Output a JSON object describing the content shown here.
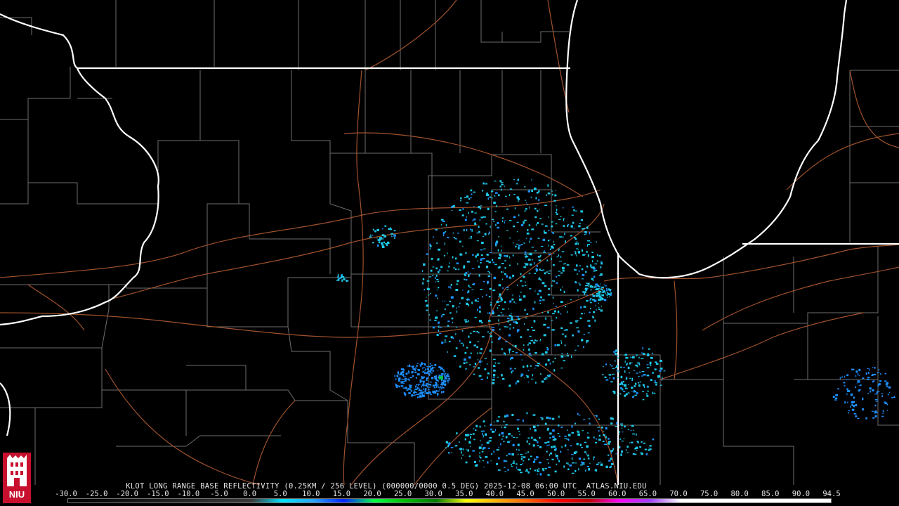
{
  "product": {
    "title_line": "KLOT LONG RANGE BASE REFLECTIVITY (0.25KM / 256 LEVEL) (000000/0000 0.5 DEG) 2025-12-08 06:00 UTC  ATLAS.NIU.EDU",
    "logo_text": "NIU"
  },
  "colorbar": {
    "tick_labels": [
      "-30.0",
      "-25.0",
      "-20.0",
      "-15.0",
      "-10.0",
      "-5.0",
      "0.0",
      "5.0",
      "10.0",
      "15.0",
      "20.0",
      "25.0",
      "30.0",
      "35.0",
      "40.0",
      "45.0",
      "50.0",
      "55.0",
      "60.0",
      "65.0",
      "70.0",
      "75.0",
      "80.0",
      "85.0",
      "90.0",
      "94.5"
    ],
    "stops": [
      {
        "value": -30,
        "color": "#000000"
      },
      {
        "value": 0,
        "color": "#3a3a3a"
      },
      {
        "value": 5,
        "color": "#00e5ff"
      },
      {
        "value": 10,
        "color": "#2aa6ff"
      },
      {
        "value": 15,
        "color": "#0022ff"
      },
      {
        "value": 20,
        "color": "#00ff44"
      },
      {
        "value": 25,
        "color": "#00c000"
      },
      {
        "value": 30,
        "color": "#007a00"
      },
      {
        "value": 35,
        "color": "#ffff00"
      },
      {
        "value": 40,
        "color": "#ffb000"
      },
      {
        "value": 45,
        "color": "#ff6000"
      },
      {
        "value": 50,
        "color": "#ff0000"
      },
      {
        "value": 55,
        "color": "#c00000"
      },
      {
        "value": 60,
        "color": "#ff00ff"
      },
      {
        "value": 65,
        "color": "#a040ff"
      },
      {
        "value": 70,
        "color": "#ffffff"
      },
      {
        "value": 94.5,
        "color": "#ffffff"
      }
    ]
  },
  "colors": {
    "background": "#000000",
    "state_border": "#ffffff",
    "county_border": "#7a7a7a",
    "highway": "#a0522d",
    "echo_light": "#1ec8e8",
    "echo_medium": "#1e90ff",
    "echo_strong": "#00c050"
  }
}
